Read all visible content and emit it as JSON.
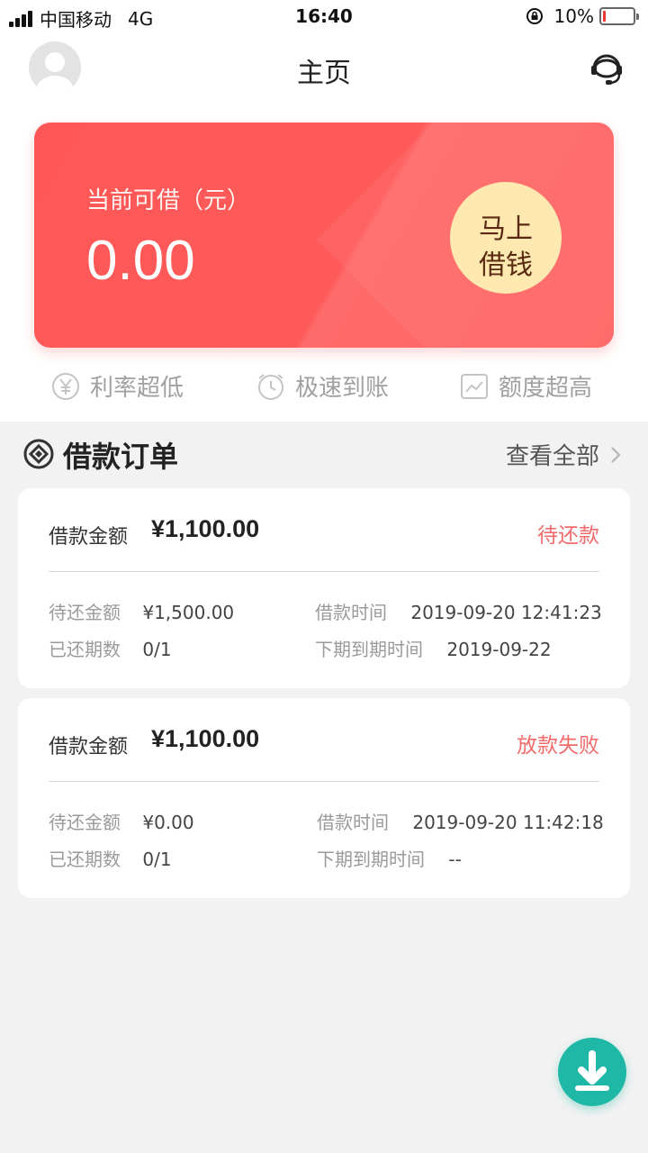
{
  "status_bar": {
    "carrier": "中国移动",
    "network": "4G",
    "time": "16:40",
    "battery_text": "10%",
    "battery_level": 0.1,
    "battery_color": "#e8392f"
  },
  "header": {
    "title": "主页",
    "avatar_icon": "user-avatar-icon",
    "service_icon": "headset-icon"
  },
  "loan_card": {
    "label": "当前可借（元）",
    "amount": "0.00",
    "button_line1": "马上",
    "button_line2": "借钱",
    "color": "#ff5a5a"
  },
  "features": [
    {
      "icon": "yen-icon",
      "label": "利率超低"
    },
    {
      "icon": "clock-icon",
      "label": "极速到账"
    },
    {
      "icon": "chart-icon",
      "label": "额度超高"
    }
  ],
  "orders": {
    "title": "借款订单",
    "view_all": "查看全部",
    "items": [
      {
        "amount_label": "借款金额",
        "amount": "¥1,100.00",
        "status": "待还款",
        "due_label": "待还金额",
        "due_value": "¥1,500.00",
        "time_label": "借款时间",
        "time_value": "2019-09-20 12:41:23",
        "periods_label": "已还期数",
        "periods_value": "0/1",
        "next_label": "下期到期时间",
        "next_value": "2019-09-22"
      },
      {
        "amount_label": "借款金额",
        "amount": "¥1,100.00",
        "status": "放款失败",
        "due_label": "待还金额",
        "due_value": "¥0.00",
        "time_label": "借款时间",
        "time_value": "2019-09-20 11:42:18",
        "periods_label": "已还期数",
        "periods_value": "0/1",
        "next_label": "下期到期时间",
        "next_value": "--"
      }
    ]
  },
  "fab": {
    "icon": "download-icon",
    "color": "#1fb8a6"
  }
}
